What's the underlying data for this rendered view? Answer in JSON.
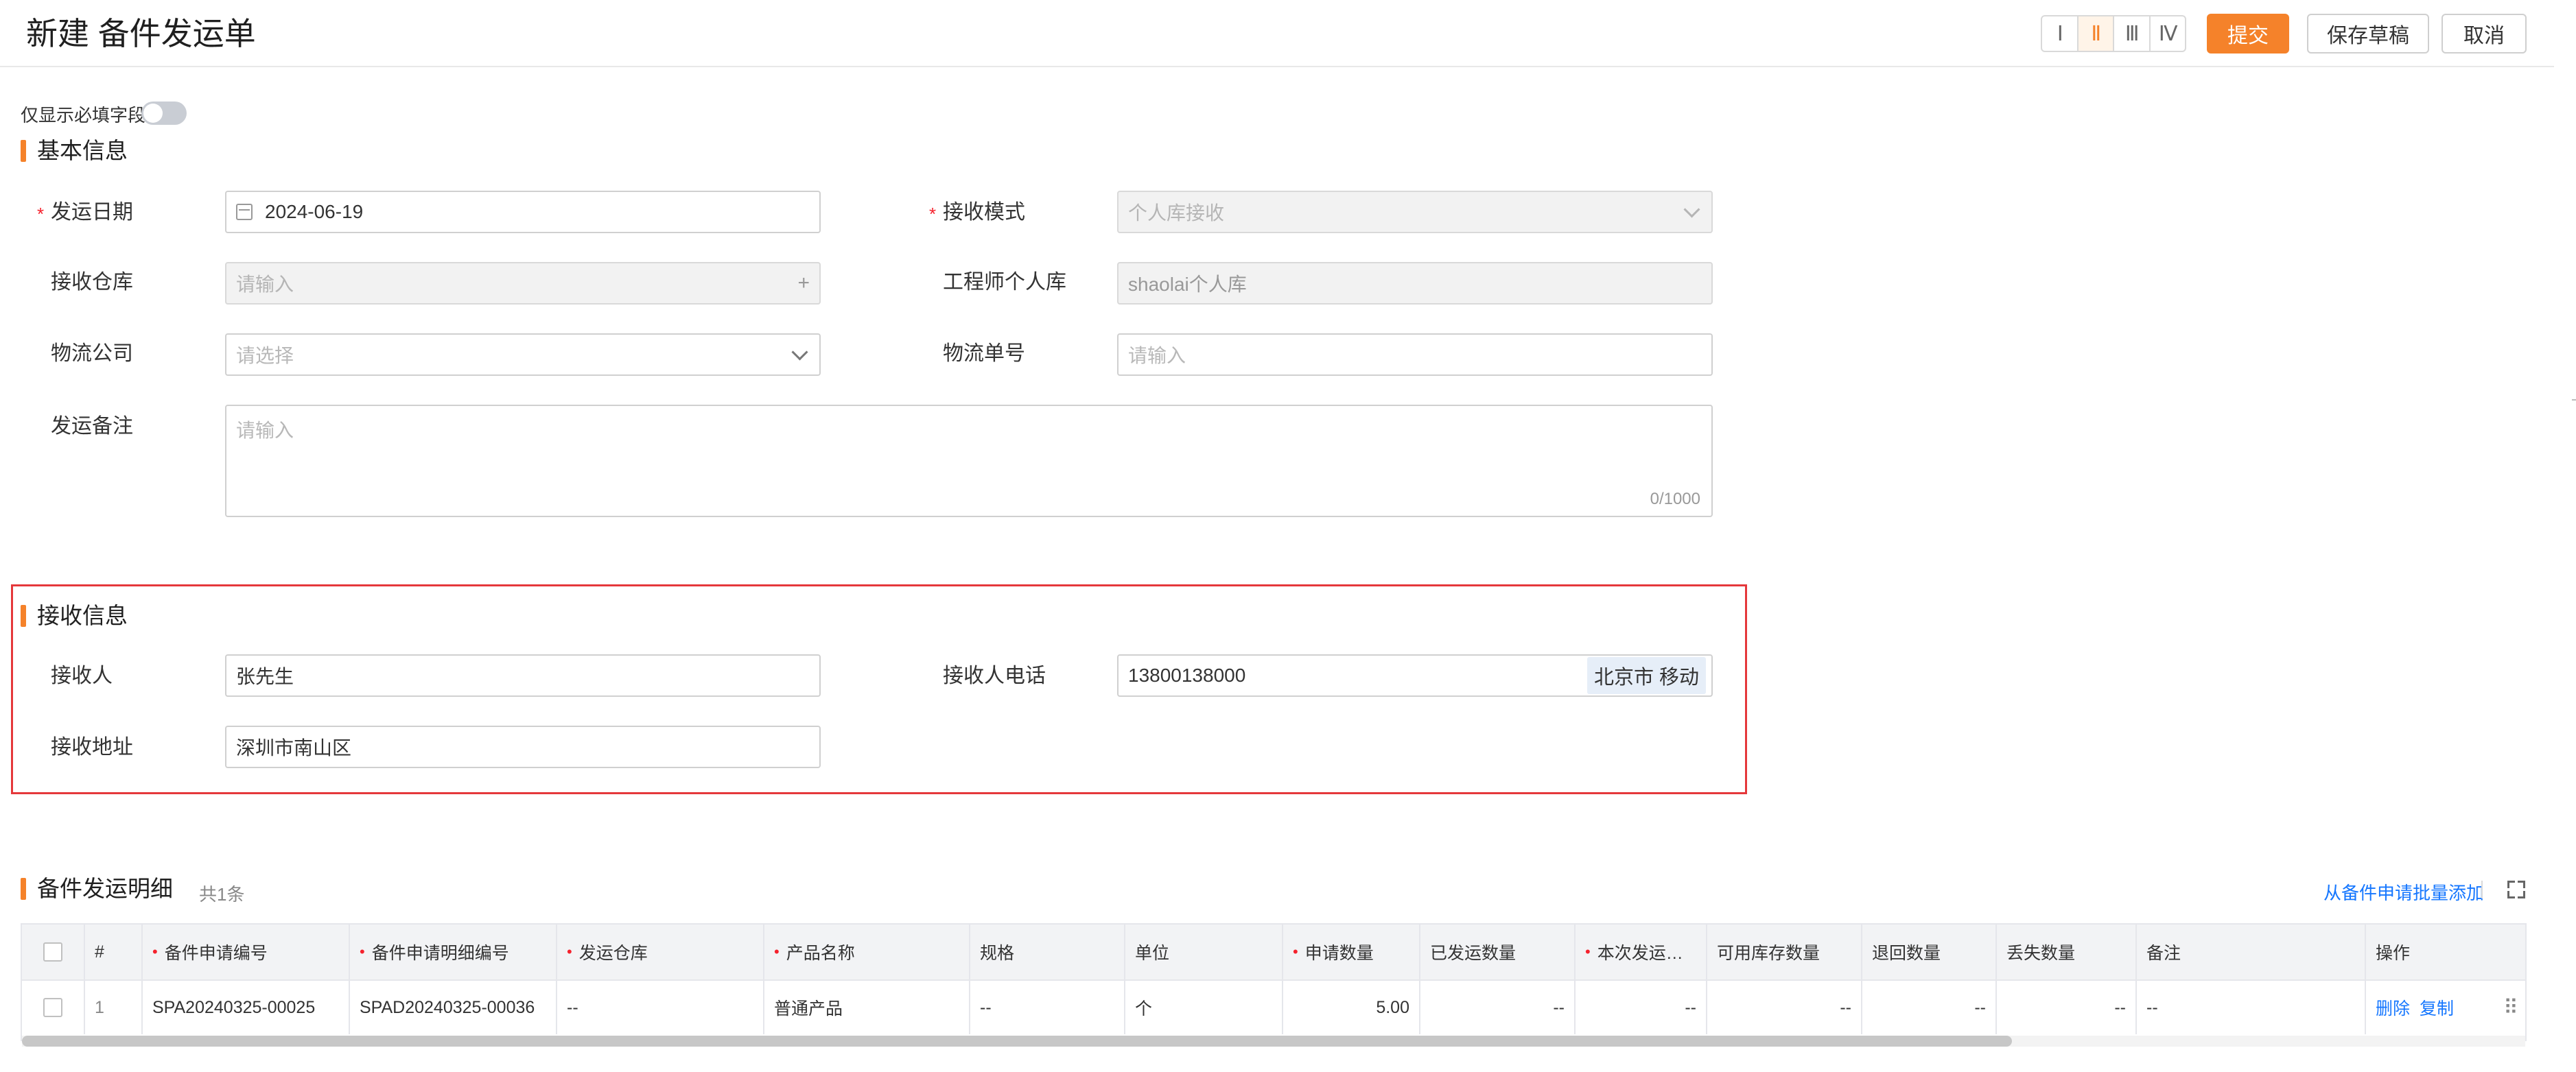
{
  "header": {
    "title": "新建 备件发运单",
    "layout_options": [
      "Ⅰ",
      "Ⅱ",
      "Ⅲ",
      "Ⅳ"
    ],
    "submit_label": "提交",
    "draft_label": "保存草稿",
    "cancel_label": "取消"
  },
  "toggle": {
    "label": "仅显示必填字段",
    "on": false
  },
  "basic_info": {
    "title": "基本信息",
    "ship_date": {
      "label": "发运日期",
      "value": "2024-06-19",
      "required": true
    },
    "receive_mode": {
      "label": "接收模式",
      "value": "个人库接收",
      "required": true
    },
    "receive_warehouse": {
      "label": "接收仓库",
      "placeholder": "请输入"
    },
    "engineer_warehouse": {
      "label": "工程师个人库",
      "value": "shaolai个人库"
    },
    "logistics_company": {
      "label": "物流公司",
      "placeholder": "请选择"
    },
    "tracking_no": {
      "label": "物流单号",
      "placeholder": "请输入"
    },
    "remark": {
      "label": "发运备注",
      "placeholder": "请输入",
      "counter": "0/1000"
    }
  },
  "receive_info": {
    "title": "接收信息",
    "receiver": {
      "label": "接收人",
      "value": "张先生"
    },
    "phone": {
      "label": "接收人电话",
      "value": "13800138000",
      "location_tag": "北京市 移动"
    },
    "address": {
      "label": "接收地址",
      "value": "深圳市南山区"
    }
  },
  "detail_table": {
    "title": "备件发运明细",
    "count": "共1条",
    "batch_add_label": "从备件申请批量添加",
    "columns": [
      "#",
      "备件申请编号",
      "备件申请明细编号",
      "发运仓库",
      "产品名称",
      "规格",
      "单位",
      "申请数量",
      "已发运数量",
      "本次发运…",
      "可用库存数量",
      "退回数量",
      "丢失数量",
      "备注",
      "操作"
    ],
    "rows": [
      {
        "index": "1",
        "apply_no": "SPA20240325-00025",
        "apply_detail_no": "SPAD20240325-00036",
        "warehouse": "--",
        "product_name": "普通产品",
        "spec": "--",
        "unit": "个",
        "apply_qty": "5.00",
        "shipped_qty": "--",
        "this_ship_qty": "--",
        "stock_qty": "--",
        "return_qty": "--",
        "lost_qty": "--",
        "remark": "--",
        "delete_label": "删除",
        "copy_label": "复制"
      }
    ]
  },
  "colors": {
    "accent": "#f5822a",
    "link": "#1677ff",
    "highlight_border": "#e5383b",
    "required": "#f5222d"
  }
}
